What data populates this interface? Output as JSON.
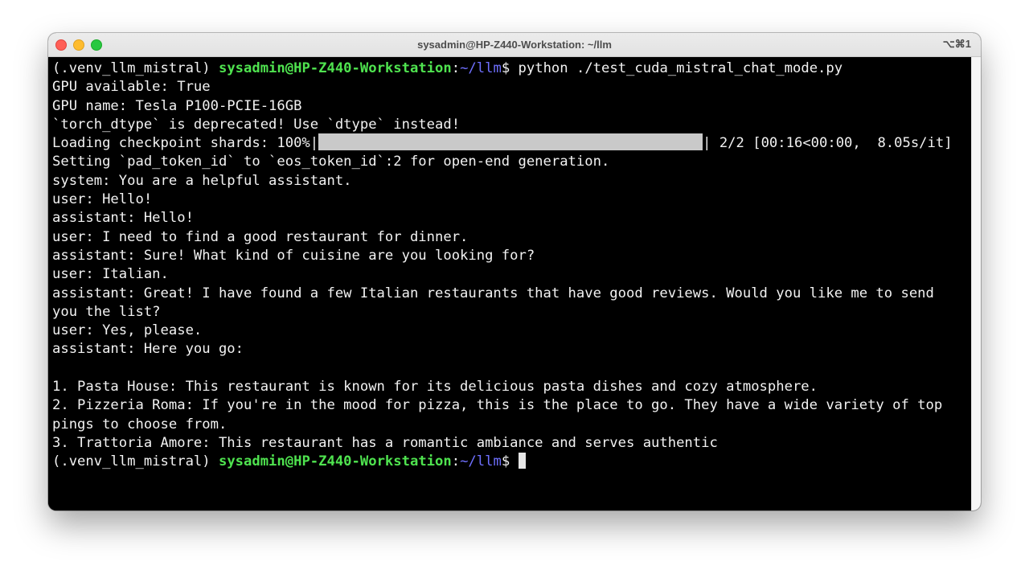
{
  "window": {
    "title": "sysadmin@HP-Z440-Workstation: ~/llm",
    "shortcut": "⌥⌘1"
  },
  "terminal": {
    "prompt": {
      "venv": "(.venv_llm_mistral) ",
      "userhost": "sysadmin@HP-Z440-Workstation",
      "colon": ":",
      "path": "~/llm",
      "dollar": "$ "
    },
    "command": "python ./test_cuda_mistral_chat_mode.py",
    "output_before_progress": [
      "GPU available: True",
      "GPU name: Tesla P100-PCIE-16GB",
      "`torch_dtype` is deprecated! Use `dtype` instead!"
    ],
    "progress": {
      "prefix": "Loading checkpoint shards: 100%|",
      "suffix": "| 2/2 [00:16<00:00,  8.05s/it]",
      "fraction": 1.0
    },
    "output_after_progress": [
      "Setting `pad_token_id` to `eos_token_id`:2 for open-end generation.",
      "system: You are a helpful assistant.",
      "user: Hello!",
      "assistant: Hello!",
      "user: I need to find a good restaurant for dinner.",
      "assistant: Sure! What kind of cuisine are you looking for?",
      "user: Italian.",
      "assistant: Great! I have found a few Italian restaurants that have good reviews. Would you like me to send",
      "you the list?",
      "user: Yes, please.",
      "assistant: Here you go:",
      "",
      "1. Pasta House: This restaurant is known for its delicious pasta dishes and cozy atmosphere.",
      "2. Pizzeria Roma: If you're in the mood for pizza, this is the place to go. They have a wide variety of top",
      "pings to choose from.",
      "3. Trattoria Amore: This restaurant has a romantic ambiance and serves authentic"
    ]
  }
}
